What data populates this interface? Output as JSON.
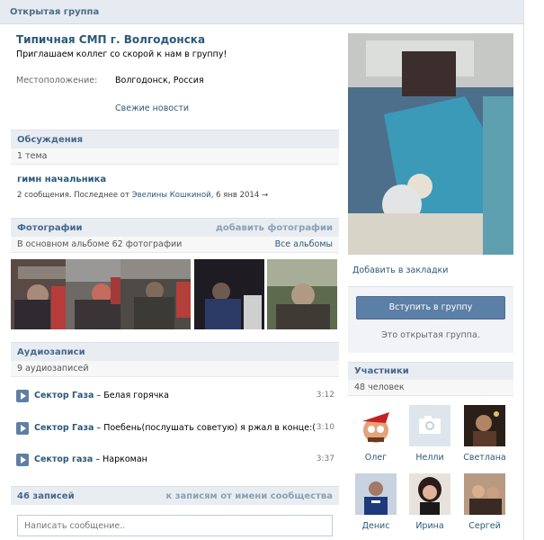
{
  "topbar": {
    "title": "Открытая группа"
  },
  "group": {
    "name": "Типичная СМП г. Волгодонска",
    "status": "Приглашаем коллег со скорой к нам в группу!",
    "location_label": "Местоположение:",
    "location_value": "Волгодонск, Россия",
    "fresh_news": "Свежие новости"
  },
  "discussions": {
    "header": "Обсуждения",
    "count": "1 тема",
    "topic_title": "гимн начальника",
    "topic_meta_prefix": "2 сообщения. Последнее от ",
    "topic_meta_author": "Эвелины Кошкиной",
    "topic_meta_date": ", 6 янв 2014",
    "topic_meta_arrow": "→"
  },
  "photos": {
    "header": "Фотографии",
    "add": "добавить фотографии",
    "album_info": "В основном альбоме 62 фотографии",
    "all_albums": "Все альбомы"
  },
  "audio": {
    "header": "Аудиозаписи",
    "count": "9 аудиозаписей",
    "tracks": [
      {
        "artist": "Сектор Газа",
        "title": " – Белая горячка",
        "duration": "3:12"
      },
      {
        "artist": "Сектор Газа",
        "title": " – Поебень(послушать советую) я ржал в конце:(",
        "duration": "3:10"
      },
      {
        "artist": "Сектор газа",
        "title": " – Наркоман",
        "duration": "3:37"
      }
    ]
  },
  "wall": {
    "count": "46 записей",
    "to_community": "к записям от имени сообщества",
    "placeholder": "Написать сообщение.."
  },
  "sidebar": {
    "bookmark": "Добавить в закладки",
    "join_button": "Вступить в группу",
    "open_note": "Это открытая группа.",
    "members_header": "Участники",
    "members_count": "48 человек",
    "members": [
      {
        "name": "Олег"
      },
      {
        "name": "Нелли"
      },
      {
        "name": "Светлана"
      },
      {
        "name": "Денис"
      },
      {
        "name": "Ирина"
      },
      {
        "name": "Сергей"
      }
    ]
  },
  "colors": {
    "link": "#2b587a",
    "header_bg": "#e9edf1",
    "button": "#5b7fa6"
  }
}
